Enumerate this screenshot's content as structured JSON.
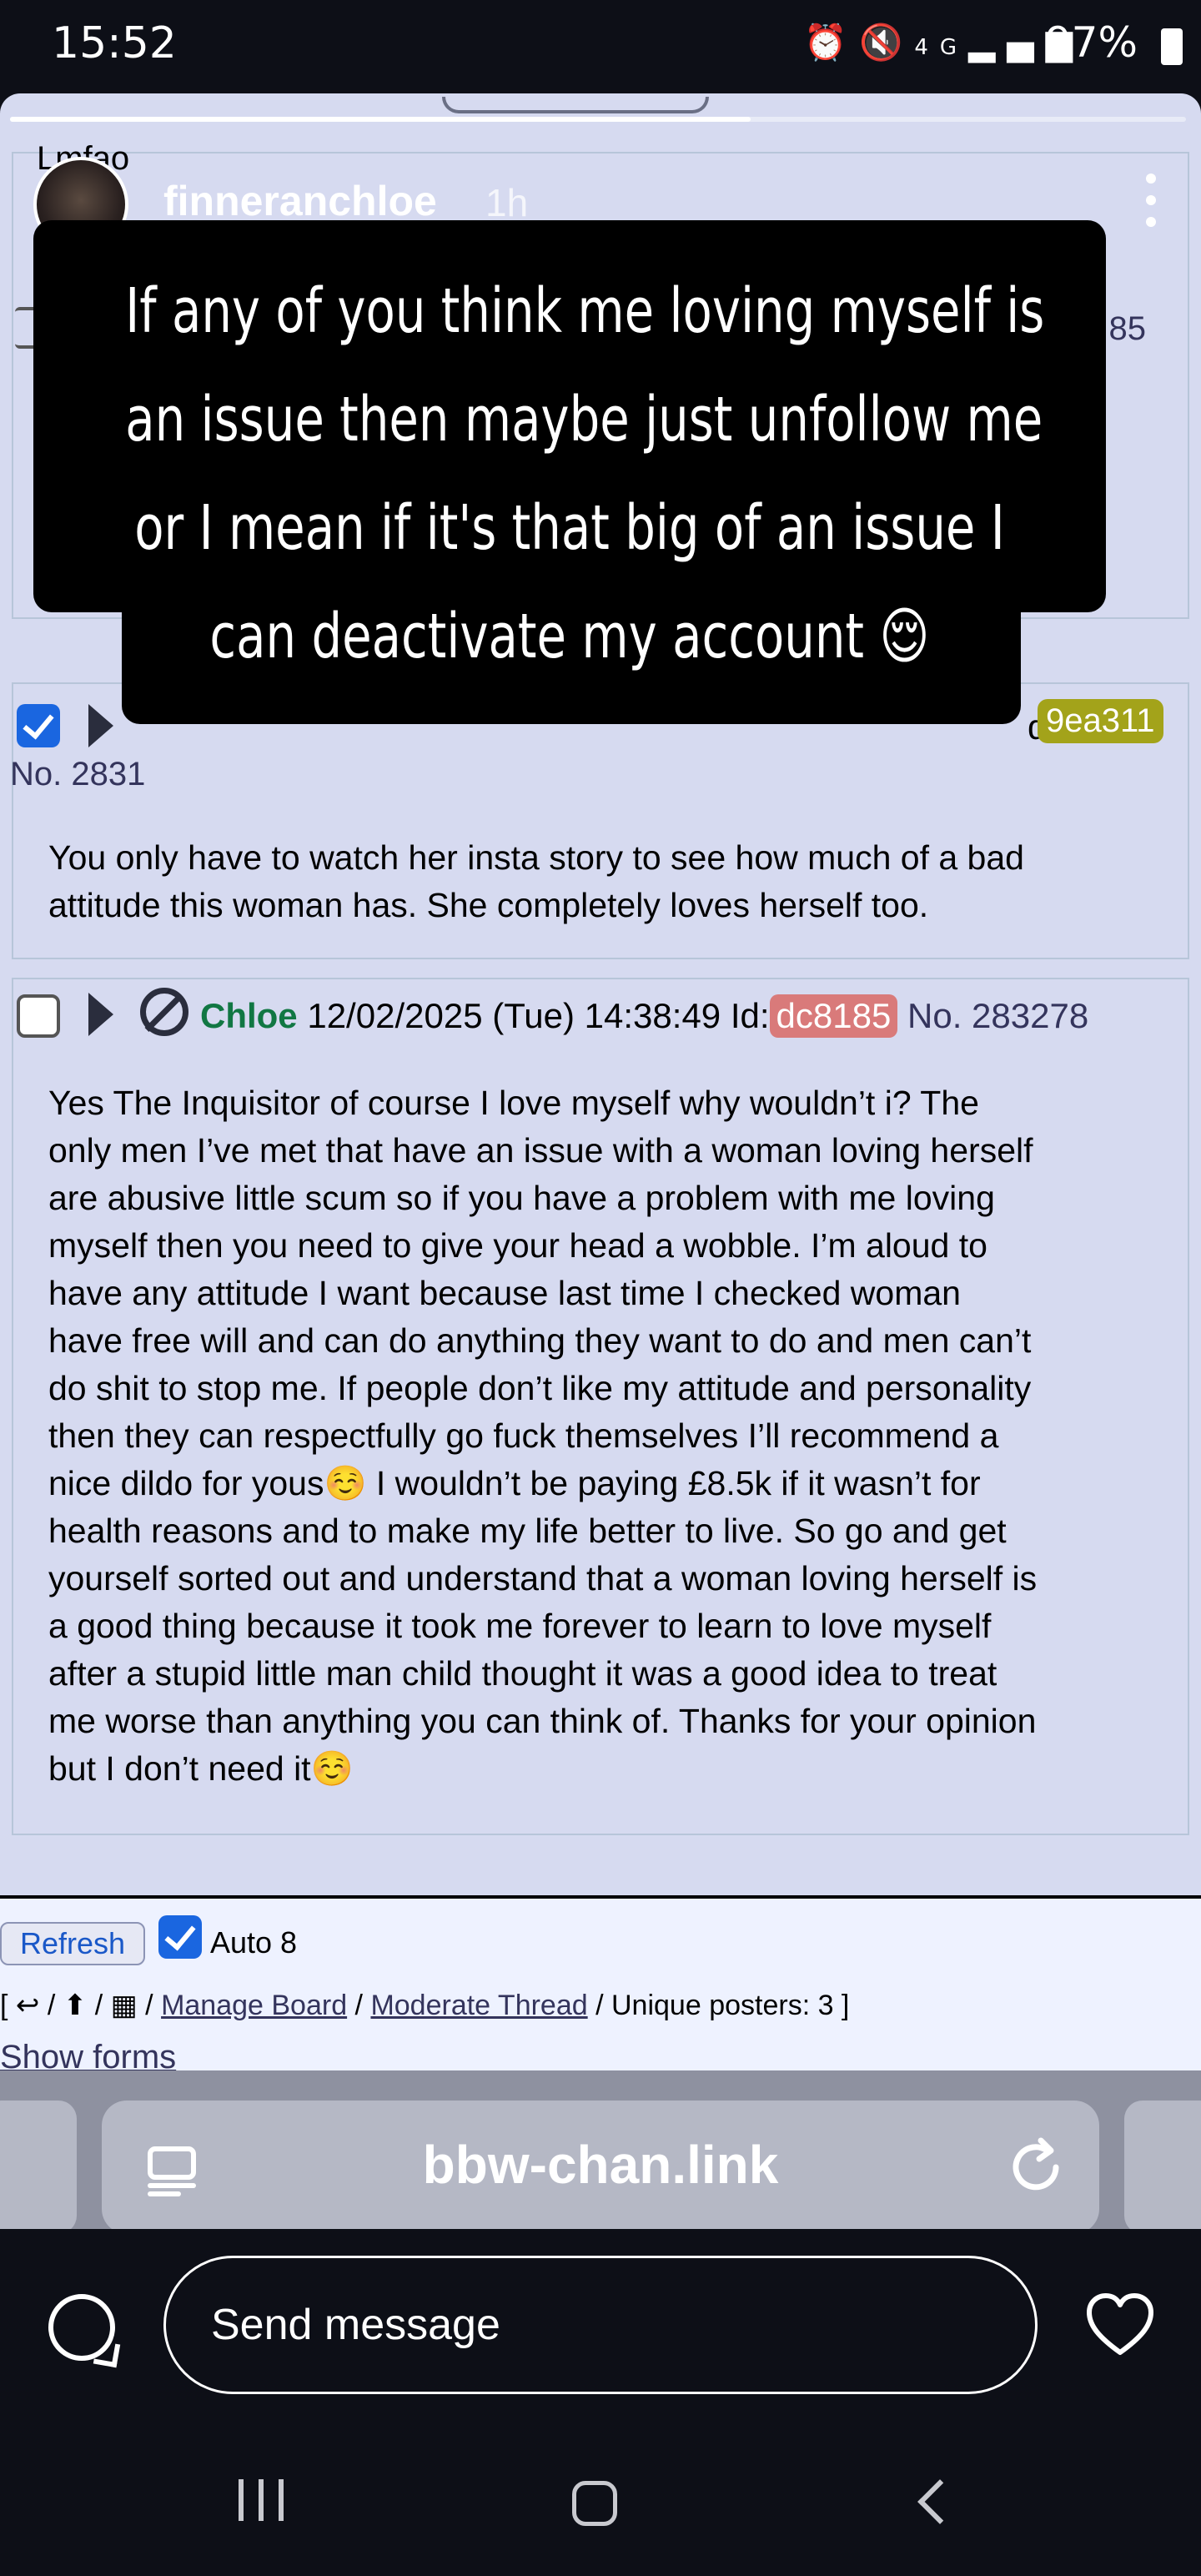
{
  "status_bar": {
    "time": "15:52",
    "battery": "97%",
    "network": "4G"
  },
  "story": {
    "username": "finneranchloe",
    "posted": "1h",
    "progress_fraction": 0.63,
    "caption_lines": [
      "If any of you think me loving myself is",
      "an issue then maybe just unfollow me",
      "or I mean if it's that big of an issue I",
      "can deactivate my account 😌"
    ]
  },
  "forum": {
    "post1_text_fragment": "Lmfao",
    "post1_number_fragment": "85",
    "post2": {
      "id_suffix": "d:",
      "id_badge": "9ea311",
      "id_badge_color": "#a3a31a",
      "number_fragment": "No. 2831",
      "body": [
        "You only have to watch her insta story to see how much of a bad",
        "attitude this woman has. She completely loves herself too."
      ]
    },
    "post3": {
      "name": "Chloe",
      "date": "12/02/2025 (Tue) 14:38:49",
      "id_label": "Id:",
      "id_badge": "dc8185",
      "id_badge_color": "#d97a7a",
      "number": "No. 283278",
      "body": [
        "Yes The Inquisitor of course I love myself why wouldn’t i? The",
        "only men I’ve met that have an issue with a woman loving herself",
        "are abusive little scum so if you have a problem with me loving",
        "myself then you need to give your head a wobble. I’m aloud to",
        "have any attitude I want because last time I checked woman",
        "have free will and can do anything they want to do and men can’t",
        "do shit to stop me. If people don’t like my attitude and personality",
        "then they can respectfully go fuck themselves I’ll recommend a",
        "nice dildo for yous☺️ I wouldn’t be paying £8.5k if it wasn’t for",
        "health reasons and to make my life better to live. So go and get",
        "yourself sorted out and understand that a woman loving herself is",
        "a good thing because it took me forever to learn to love myself",
        "after a stupid little man child thought it was a good idea to treat",
        "me worse than anything you can think of. Thanks for your opinion",
        "but I don’t need it☺️"
      ]
    },
    "footer": {
      "refresh_label": "Refresh",
      "auto_label": "Auto 8",
      "manage_board": "Manage Board",
      "moderate_thread": "Moderate Thread",
      "unique_posters": "/ Unique posters: 3 ]",
      "show_forms": "Show forms"
    }
  },
  "browser": {
    "url": "bbw-chan.link"
  },
  "reply": {
    "placeholder": "Send message"
  }
}
